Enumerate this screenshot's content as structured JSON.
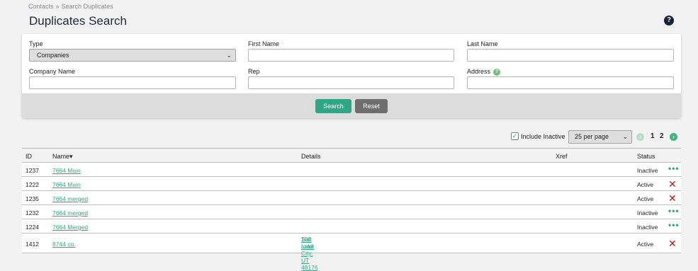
{
  "breadcrumb": {
    "parent": "Contacts",
    "separator": "»",
    "current": "Search Duplicates"
  },
  "page": {
    "title": "Duplicates Search",
    "help_icon": "?"
  },
  "form": {
    "type_label": "Type",
    "type_value": "Companies",
    "first_name_label": "First Name",
    "first_name_value": "",
    "last_name_label": "Last Name",
    "last_name_value": "",
    "company_name_label": "Company Name",
    "company_name_value": "",
    "rep_label": "Rep",
    "rep_value": "",
    "address_label": "Address",
    "address_help_icon": "?",
    "address_value": "",
    "search_label": "Search",
    "reset_label": "Reset"
  },
  "controls": {
    "include_inactive_label": "Include Inactive",
    "include_inactive_checked": true,
    "per_page": "25 per page",
    "pages": [
      "1",
      "2"
    ]
  },
  "table": {
    "headers": {
      "id": "ID",
      "name": "Name▾",
      "details": "Details",
      "xref": "Xref",
      "status": "Status"
    },
    "rows": [
      {
        "id": "1237",
        "name": "7664 Main",
        "details": [],
        "xref": "",
        "status": "Inactive",
        "action": "more-icon"
      },
      {
        "id": "1222",
        "name": "7664 Main",
        "details": [],
        "xref": "",
        "status": "Active",
        "action": "delete-icon"
      },
      {
        "id": "1235",
        "name": "7664 merged",
        "details": [],
        "xref": "",
        "status": "Active",
        "action": "delete-icon"
      },
      {
        "id": "1232",
        "name": "7664 merged",
        "details": [],
        "xref": "",
        "status": "Inactive",
        "action": "more-icon"
      },
      {
        "id": "1224",
        "name": "7664 Merged",
        "details": [],
        "xref": "",
        "status": "Inactive",
        "action": "more-icon"
      },
      {
        "id": "1412",
        "name": "8744 co.",
        "details": [
          "100 road",
          "Salt Lake City, UT 48176"
        ],
        "xref": "",
        "status": "Active",
        "action": "delete-icon"
      }
    ]
  },
  "colors": {
    "accent": "#2ea884",
    "danger": "#c0161b",
    "reset": "#6e6e6e"
  }
}
